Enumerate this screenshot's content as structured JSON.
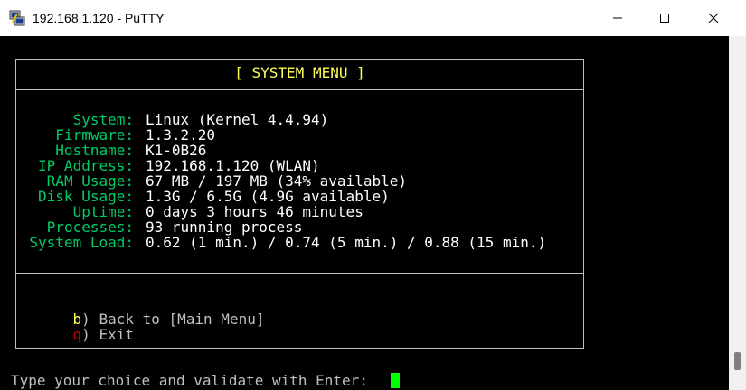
{
  "window": {
    "title": "192.168.1.120 - PuTTY"
  },
  "menu": {
    "title": "[ SYSTEM MENU ]"
  },
  "info": [
    {
      "label": "System:",
      "value": "Linux (Kernel 4.4.94)"
    },
    {
      "label": "Firmware:",
      "value": "1.3.2.20"
    },
    {
      "label": "Hostname:",
      "value": "K1-0B26"
    },
    {
      "label": "IP Address:",
      "value": "192.168.1.120 (WLAN)"
    },
    {
      "label": "RAM Usage:",
      "value": "67 MB / 197 MB (34% available)"
    },
    {
      "label": "Disk Usage:",
      "value": "1.3G / 6.5G (4.9G available)"
    },
    {
      "label": "Uptime:",
      "value": "0 days 3 hours 46 minutes"
    },
    {
      "label": "Processes:",
      "value": "93 running process"
    },
    {
      "label": "System Load:",
      "value": "0.62 (1 min.) / 0.74 (5 min.) / 0.88 (15 min.)"
    }
  ],
  "options": [
    {
      "key": "b",
      "label": ") Back to [Main Menu]"
    },
    {
      "key": "q",
      "label": ") Exit"
    }
  ],
  "prompt": "Type your choice and validate with Enter: ",
  "colors": {
    "label": "#00cc66",
    "title": "#ffff55",
    "key_back": "#ffff55",
    "key_exit": "#cc0000",
    "cursor": "#00ff00"
  }
}
